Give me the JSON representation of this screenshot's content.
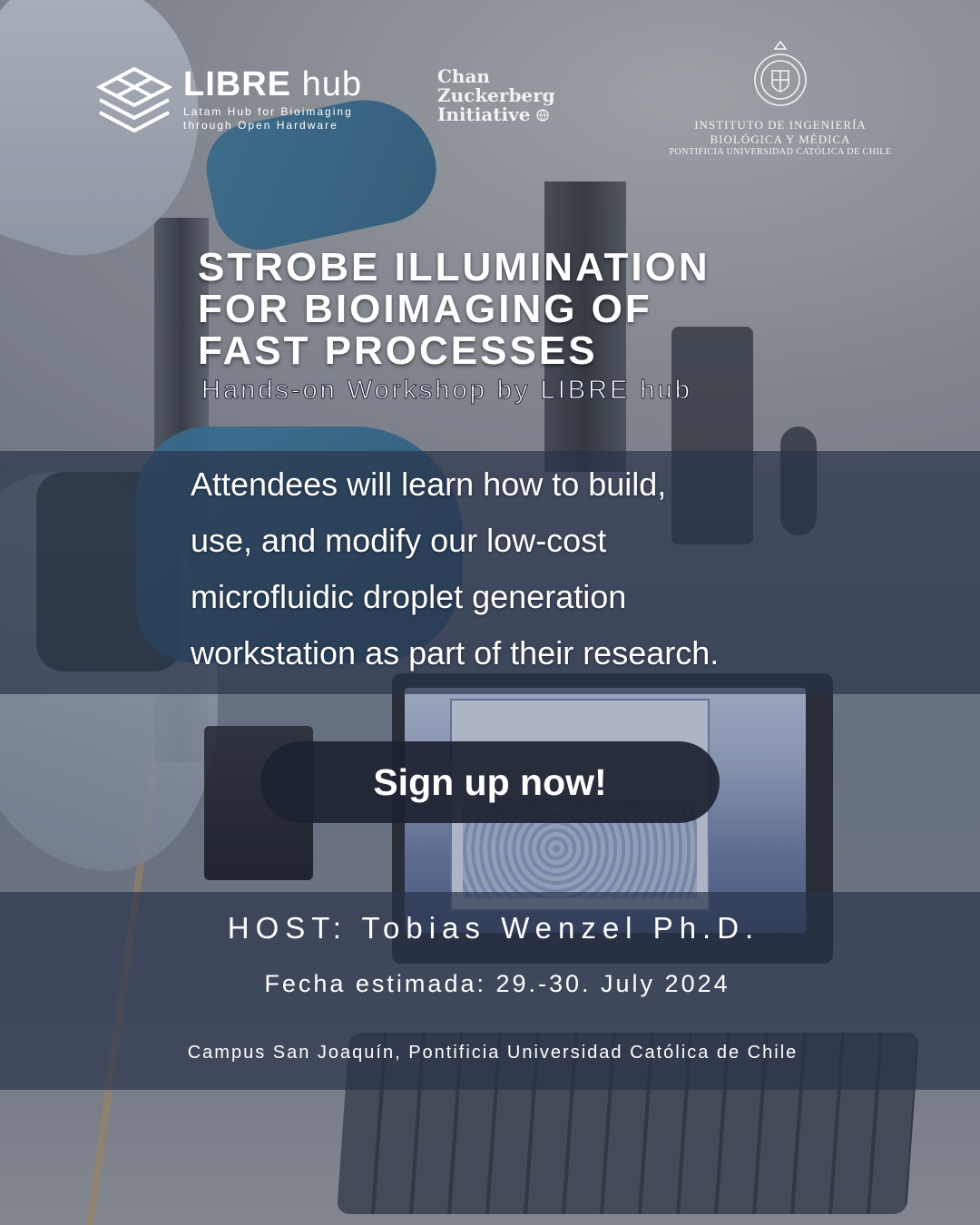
{
  "logos": {
    "libre": {
      "name_bold": "LIBRE",
      "name_light": "hub",
      "tagline_1": "Latam Hub for Bioimaging",
      "tagline_2": "through Open Hardware"
    },
    "czi": {
      "line_1": "Chan",
      "line_2": "Zuckerberg",
      "line_3": "Initiative"
    },
    "ibm": {
      "line_1": "INSTITUTO DE INGENIERÍA",
      "line_2": "BIOLÓGICA Y MÉDICA",
      "line_3": "PONTIFICIA UNIVERSIDAD CATÓLICA DE CHILE"
    }
  },
  "headline": {
    "line_1": "STROBE ILLUMINATION",
    "line_2": "FOR BIOIMAGING OF",
    "line_3": "FAST PROCESSES",
    "subtitle": "Hands-on Workshop by LIBRE hub"
  },
  "description": {
    "line_1": "Attendees will learn how to build,",
    "line_2": "use, and modify our low-cost",
    "line_3": "microfluidic droplet  generation",
    "line_4": "workstation as part of their research."
  },
  "cta": {
    "label": "Sign up now!"
  },
  "details": {
    "host": "HOST: Tobias Wenzel Ph.D.",
    "date": "Fecha estimada: 29.-30. July 2024",
    "venue": "Campus San Joaquín, Pontificia Universidad Católica de Chile"
  },
  "icons": {
    "libre_mark": "libre-hub-logo-icon",
    "ibm_seal": "university-seal-icon",
    "czi_mark": "czi-globe-icon"
  },
  "colors": {
    "band": "#283248",
    "button": "#1c2230",
    "text": "#ffffff"
  }
}
